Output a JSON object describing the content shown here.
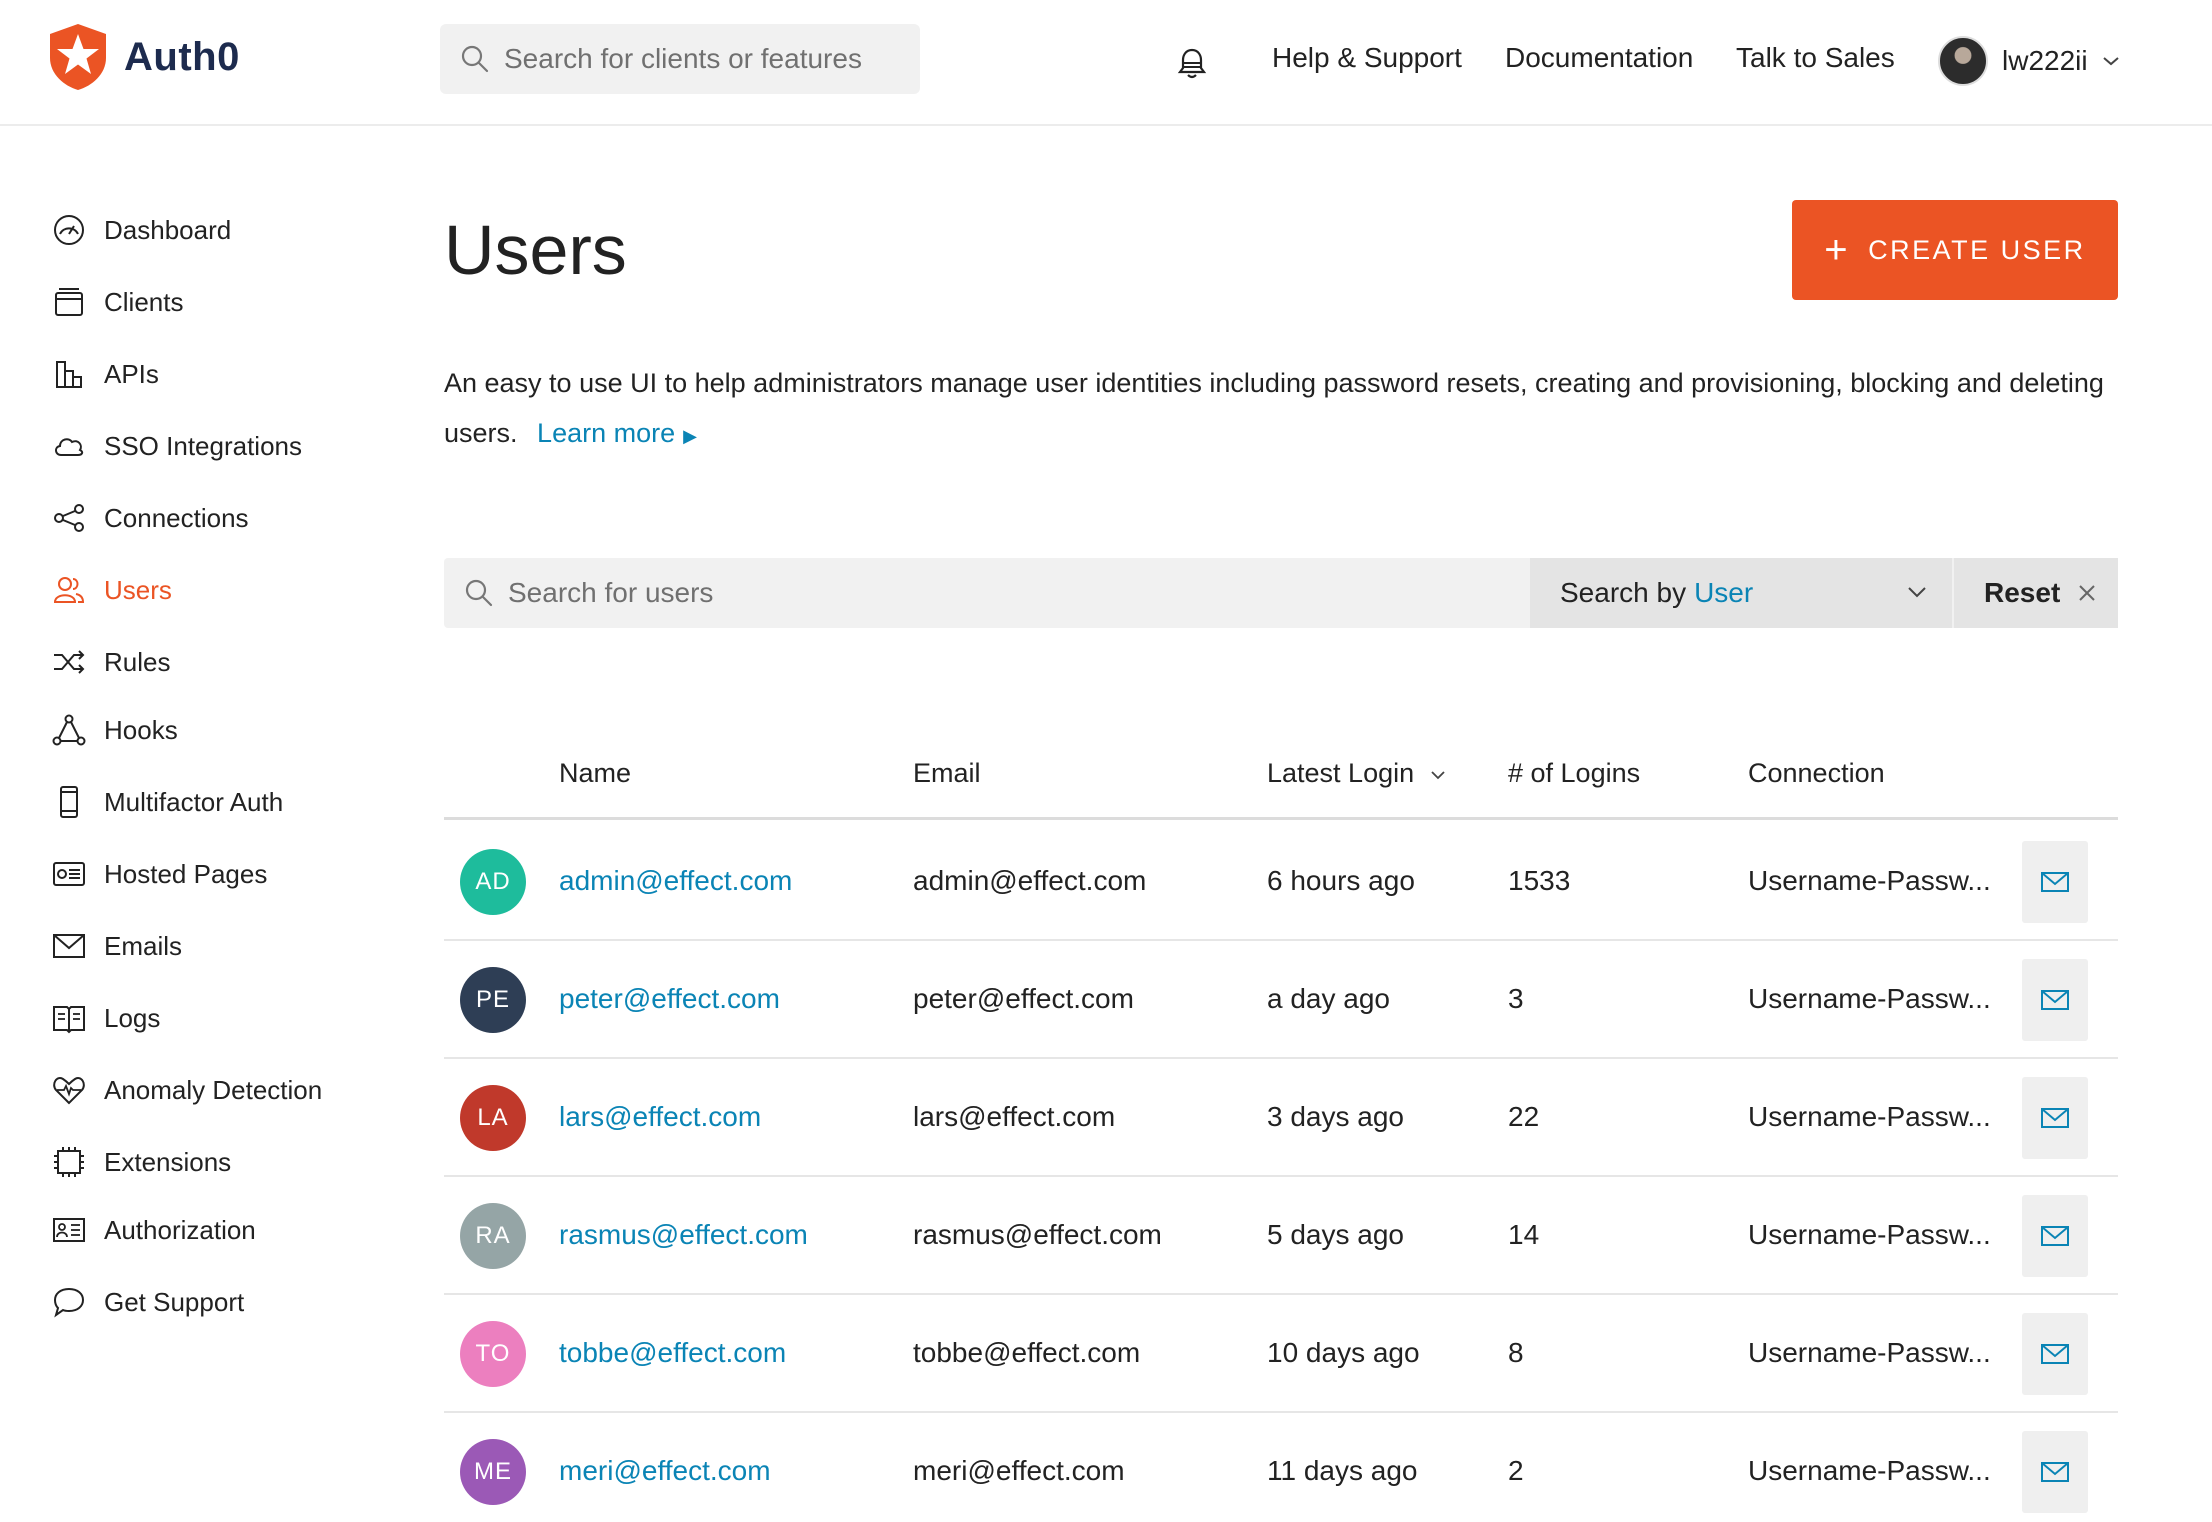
{
  "brand": {
    "name": "Auth0",
    "accent": "#eb5424",
    "link_color": "#0a84b5"
  },
  "header": {
    "search_placeholder": "Search for clients or features",
    "nav": [
      "Help & Support",
      "Documentation",
      "Talk to Sales"
    ],
    "username": "lw222ii"
  },
  "sidebar": {
    "items": [
      {
        "label": "Dashboard",
        "icon": "dashboard-icon"
      },
      {
        "label": "Clients",
        "icon": "clients-icon"
      },
      {
        "label": "APIs",
        "icon": "apis-icon"
      },
      {
        "label": "SSO Integrations",
        "icon": "cloud-icon"
      },
      {
        "label": "Connections",
        "icon": "connections-icon"
      },
      {
        "label": "Users",
        "icon": "users-icon",
        "active": true
      },
      {
        "label": "Rules",
        "icon": "shuffle-icon"
      },
      {
        "label": "Hooks",
        "icon": "hooks-icon"
      },
      {
        "label": "Multifactor Auth",
        "icon": "phone-icon"
      },
      {
        "label": "Hosted Pages",
        "icon": "hosted-pages-icon"
      },
      {
        "label": "Emails",
        "icon": "envelope-icon"
      },
      {
        "label": "Logs",
        "icon": "book-icon"
      },
      {
        "label": "Anomaly Detection",
        "icon": "heartbeat-icon"
      },
      {
        "label": "Extensions",
        "icon": "chip-icon"
      },
      {
        "label": "Authorization",
        "icon": "id-card-icon"
      },
      {
        "label": "Get Support",
        "icon": "chat-bubble-icon"
      }
    ]
  },
  "main": {
    "title": "Users",
    "create_button": "CREATE USER",
    "description": "An easy to use UI to help administrators manage user identities including password resets, creating and provisioning, blocking and deleting users.",
    "learn_more": "Learn more",
    "search_placeholder": "Search for users",
    "search_by_label": "Search by",
    "search_by_value": "User",
    "reset_label": "Reset"
  },
  "table": {
    "columns": [
      "Name",
      "Email",
      "Latest Login",
      "# of Logins",
      "Connection"
    ],
    "rows": [
      {
        "initials": "AD",
        "color": "#1ebc9c",
        "name": "admin@effect.com",
        "email": "admin@effect.com",
        "latest_login": "6 hours ago",
        "logins": "1533",
        "connection": "Username-Passw..."
      },
      {
        "initials": "PE",
        "color": "#2e3e55",
        "name": "peter@effect.com",
        "email": "peter@effect.com",
        "latest_login": "a day ago",
        "logins": "3",
        "connection": "Username-Passw..."
      },
      {
        "initials": "LA",
        "color": "#c0392b",
        "name": "lars@effect.com",
        "email": "lars@effect.com",
        "latest_login": "3 days ago",
        "logins": "22",
        "connection": "Username-Passw..."
      },
      {
        "initials": "RA",
        "color": "#95a5a6",
        "name": "rasmus@effect.com",
        "email": "rasmus@effect.com",
        "latest_login": "5 days ago",
        "logins": "14",
        "connection": "Username-Passw..."
      },
      {
        "initials": "TO",
        "color": "#ec7fbf",
        "name": "tobbe@effect.com",
        "email": "tobbe@effect.com",
        "latest_login": "10 days ago",
        "logins": "8",
        "connection": "Username-Passw..."
      },
      {
        "initials": "ME",
        "color": "#9b59b6",
        "name": "meri@effect.com",
        "email": "meri@effect.com",
        "latest_login": "11 days ago",
        "logins": "2",
        "connection": "Username-Passw..."
      }
    ]
  }
}
